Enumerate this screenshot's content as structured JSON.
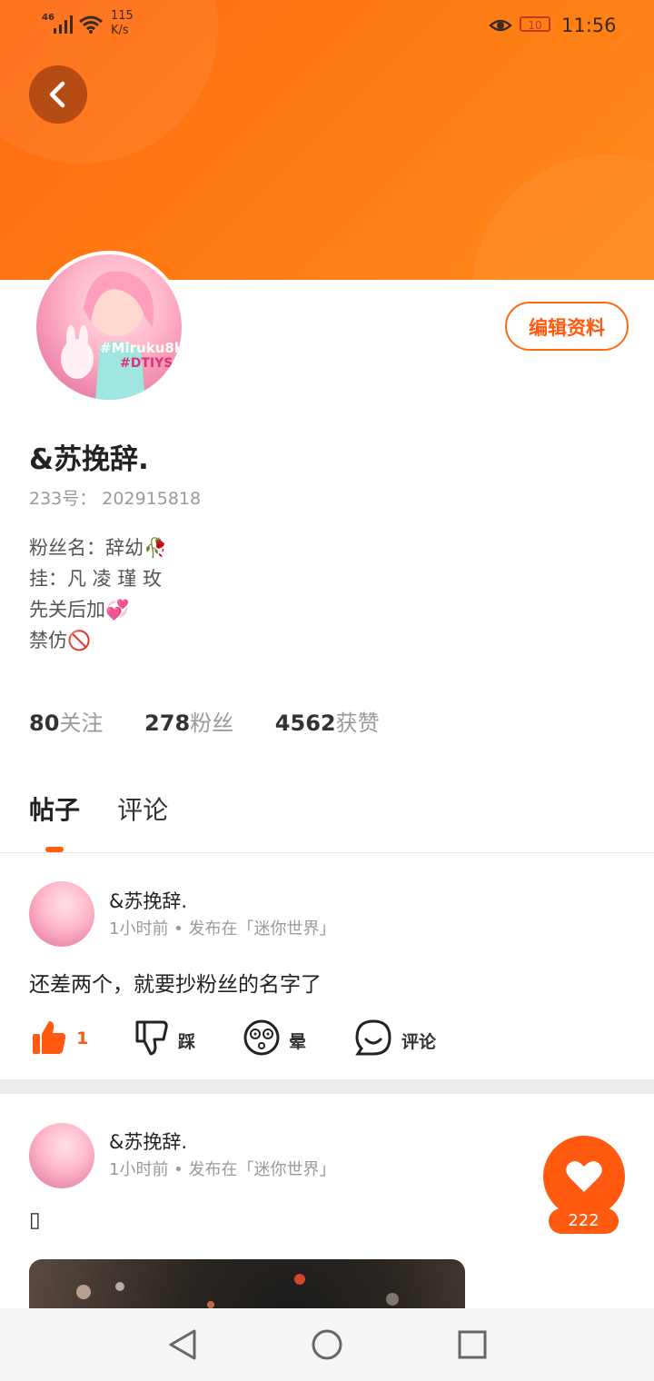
{
  "status_bar": {
    "network": "46",
    "speed_value": "115",
    "speed_unit": "K/s",
    "battery": "10",
    "time": "11:56"
  },
  "profile": {
    "name": "&苏挽辞.",
    "id_line": "233号：  202915818",
    "bio": [
      "粉丝名：辞幼🥀",
      "挂：凡 凌 瑾 玫",
      "先关后加💞",
      "禁仿🚫"
    ],
    "edit_label": "编辑资料",
    "avatar_text_1": "#Miruku8k",
    "avatar_text_2": "#DTIYS"
  },
  "stats": [
    {
      "num": "80",
      "label": "关注"
    },
    {
      "num": "278",
      "label": "粉丝"
    },
    {
      "num": "4562",
      "label": "获赞"
    }
  ],
  "tabs": [
    {
      "label": "帖子",
      "active": true
    },
    {
      "label": "评论",
      "active": false
    }
  ],
  "posts": [
    {
      "author": "&苏挽辞.",
      "meta": "1小时前 • 发布在「迷你世界」",
      "text": "还差两个，就要抄粉丝的名字了",
      "actions": {
        "like": "1",
        "dislike": "踩",
        "dizzy": "晕",
        "comment": "评论"
      }
    },
    {
      "author": "&苏挽辞.",
      "meta": "1小时前 • 发布在「迷你世界」",
      "text": "▯"
    }
  ],
  "fab": {
    "count": "222"
  },
  "colors": {
    "accent": "#ff5a10",
    "banner": "#ff7a12"
  }
}
